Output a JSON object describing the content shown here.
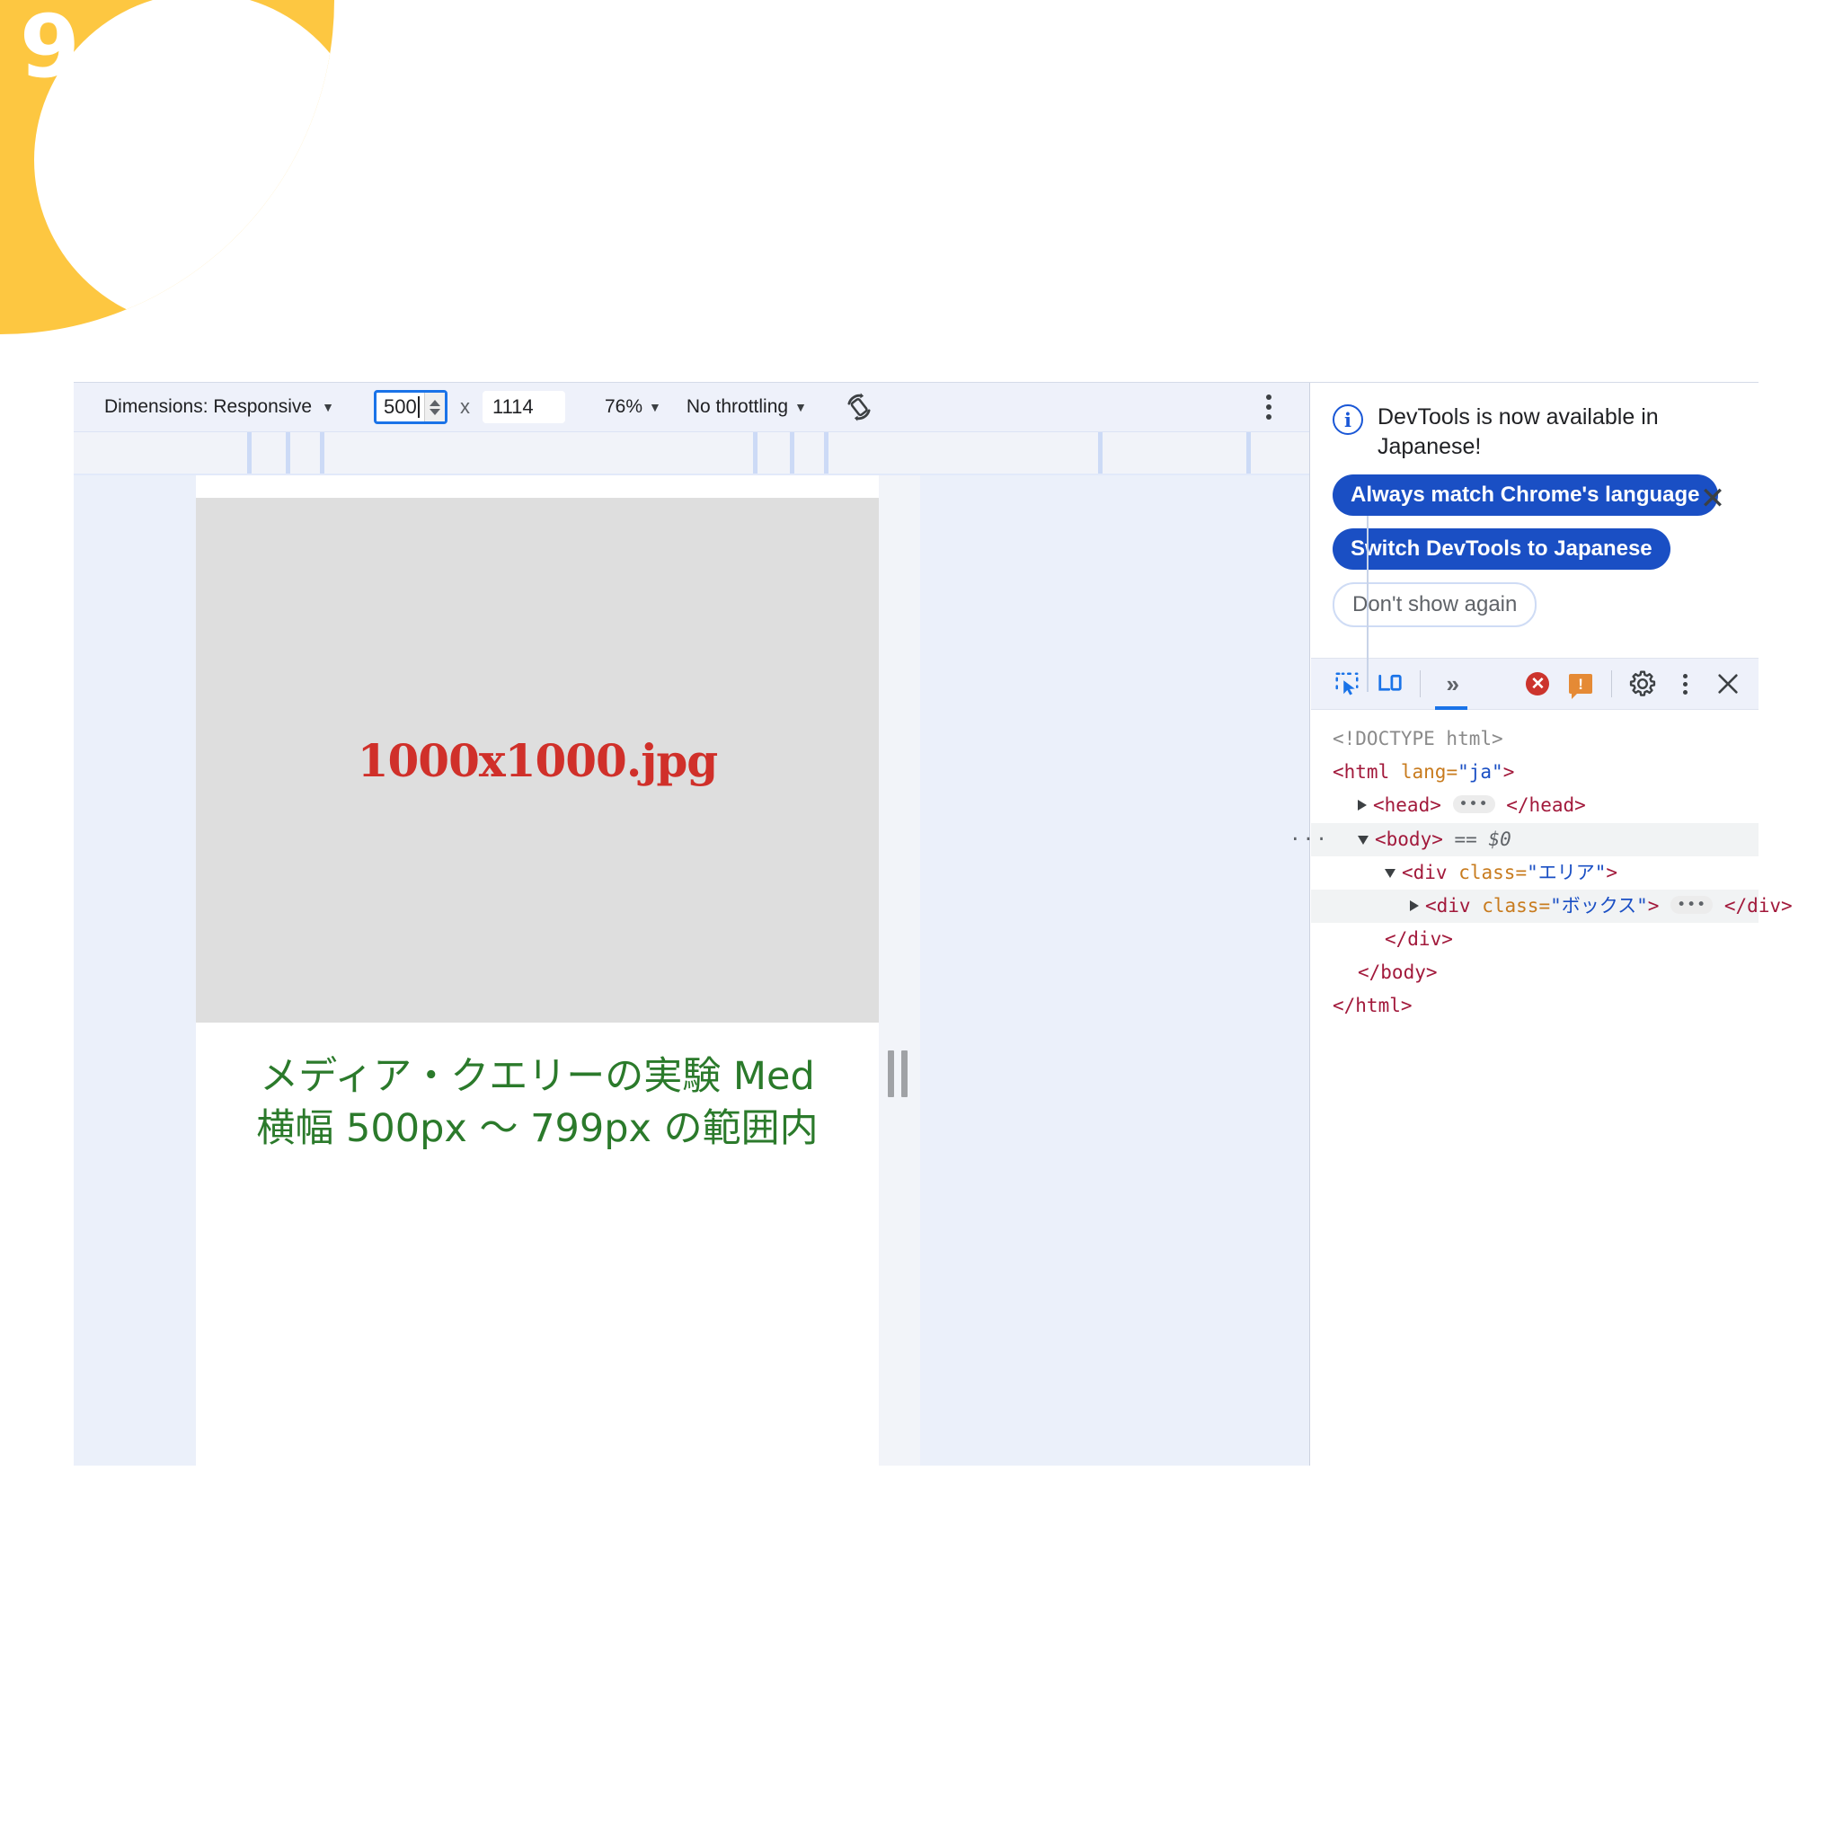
{
  "corner": {
    "number": "9",
    "color": "#FDC741"
  },
  "device_toolbar": {
    "dimensions_label": "Dimensions: Responsive",
    "width_value": "500",
    "multiply_symbol": "x",
    "height_value": "1114",
    "zoom_value": "76%",
    "throttling_value": "No throttling",
    "rotate_icon": "rotate-device-icon",
    "more_options_icon": "kebab-menu-icon"
  },
  "viewport": {
    "image_placeholder_label": "1000x1000.jpg",
    "text_line_1": "メディア・クエリーの実験 Med",
    "text_line_2": "横幅 500px 〜 799px の範囲内",
    "text_color": "#2b7a2b",
    "image_label_color": "#d0302a"
  },
  "notice": {
    "icon": "info-icon",
    "message": "DevTools is now available in Japanese!",
    "primary_button": "Always match Chrome's language",
    "secondary_button": "Switch DevTools to Japanese",
    "dismiss_button": "Don't show again",
    "close_icon": "close-icon"
  },
  "devtools_tabs": {
    "inspect_icon": "inspect-element-icon",
    "device_icon": "device-toolbar-icon",
    "more_tabs_icon": "more-tabs-chevron-icon",
    "error_count": "",
    "warning_count": "",
    "settings_icon": "gear-icon",
    "menu_icon": "kebab-menu-icon",
    "close_icon": "close-icon"
  },
  "dom_tree": {
    "doctype": "<!DOCTYPE html>",
    "html_open_tag": "<html",
    "html_attr_name": "lang",
    "html_attr_value": "\"ja\"",
    "html_close_bracket": ">",
    "head_open": "<head>",
    "head_close": "</head>",
    "body_open": "<body>",
    "body_marker": "== $0",
    "div_area_open": "<div",
    "div_area_attr": "class",
    "div_area_value": "\"エリア\"",
    "div_box_open": "<div",
    "div_box_attr": "class",
    "div_box_value": "\"ボックス\"",
    "div_close": "</div>",
    "div_area_close": "</div>",
    "body_close": "</body>",
    "html_close": "</html>",
    "ellipsis": "•••"
  }
}
